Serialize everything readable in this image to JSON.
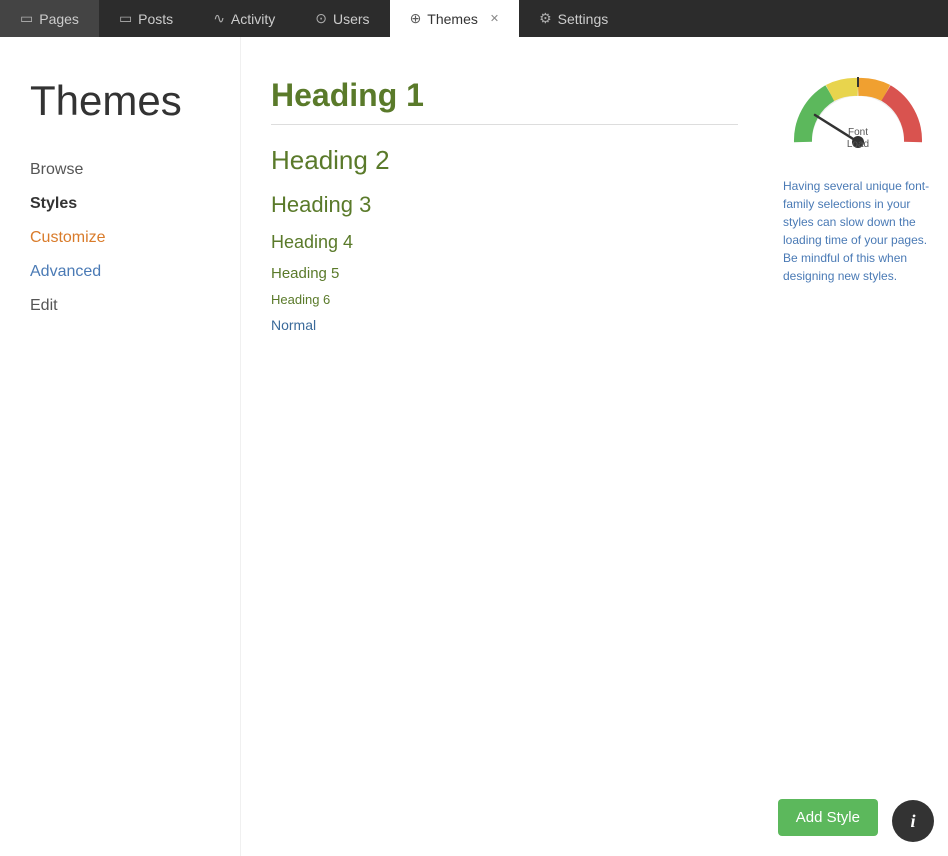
{
  "topbar": {
    "items": [
      {
        "id": "pages",
        "label": "Pages",
        "icon": "▭",
        "active": false
      },
      {
        "id": "posts",
        "label": "Posts",
        "icon": "▭",
        "active": false
      },
      {
        "id": "activity",
        "label": "Activity",
        "icon": "∿",
        "active": false
      },
      {
        "id": "users",
        "label": "Users",
        "icon": "⊙",
        "active": false
      },
      {
        "id": "themes",
        "label": "Themes",
        "icon": "⊕",
        "active": true,
        "closeable": true
      },
      {
        "id": "settings",
        "label": "Settings",
        "icon": "⚙",
        "active": false
      }
    ]
  },
  "sidebar": {
    "title": "Themes",
    "nav": [
      {
        "id": "browse",
        "label": "Browse",
        "style": "normal"
      },
      {
        "id": "styles",
        "label": "Styles",
        "style": "active"
      },
      {
        "id": "customize",
        "label": "Customize",
        "style": "orange"
      },
      {
        "id": "advanced",
        "label": "Advanced",
        "style": "blue"
      },
      {
        "id": "edit",
        "label": "Edit",
        "style": "normal"
      }
    ]
  },
  "headings": [
    {
      "id": "h1",
      "label": "Heading 1"
    },
    {
      "id": "h2",
      "label": "Heading 2"
    },
    {
      "id": "h3",
      "label": "Heading 3"
    },
    {
      "id": "h4",
      "label": "Heading 4"
    },
    {
      "id": "h5",
      "label": "Heading 5"
    },
    {
      "id": "h6",
      "label": "Heading 6"
    },
    {
      "id": "normal",
      "label": "Normal"
    }
  ],
  "gauge": {
    "label": "Font\nLoad",
    "description": "Having several unique font-family selections in your styles can slow down the loading time of your pages. Be mindful of this when designing new styles."
  },
  "buttons": {
    "add_style": "Add Style",
    "info": "i"
  }
}
